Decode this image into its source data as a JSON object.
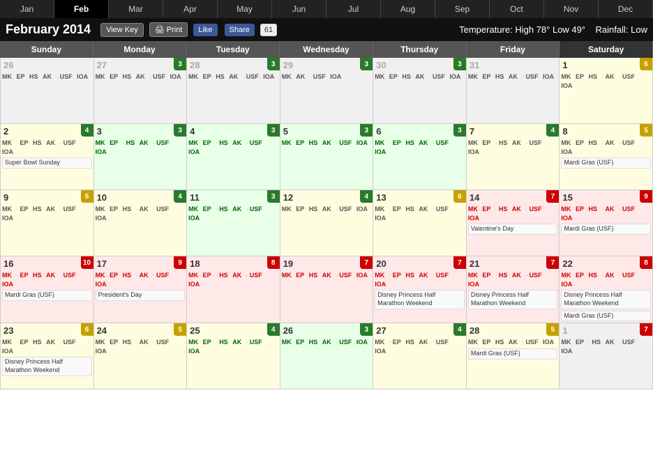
{
  "nav": {
    "months": [
      "Jan",
      "Feb",
      "Mar",
      "Apr",
      "May",
      "Jun",
      "Jul",
      "Aug",
      "Sep",
      "Oct",
      "Nov",
      "Dec"
    ],
    "active": "Feb"
  },
  "header": {
    "title": "February 2014",
    "view_key": "View Key",
    "print": "Print",
    "fb_like": "Like",
    "fb_share": "Share",
    "share_count": "61",
    "weather_label": "Temperature:",
    "weather_high": "High 78°",
    "weather_low": "Low 49°",
    "rainfall_label": "Rainfall:",
    "rainfall_value": "Low"
  },
  "dow": [
    "Sunday",
    "Monday",
    "Tuesday",
    "Wednesday",
    "Thursday",
    "Friday",
    "Saturday"
  ],
  "cells": [
    {
      "day": "26",
      "other": true,
      "crowd": null,
      "bg": "other",
      "parks": "MK EP HS AK · USF IOA",
      "parks_color": "gray",
      "events": []
    },
    {
      "day": "27",
      "other": true,
      "crowd": 3,
      "bg": "other",
      "parks": "MK EP HS AK · USF IOA",
      "parks_color": "gray",
      "events": []
    },
    {
      "day": "28",
      "other": true,
      "crowd": 3,
      "bg": "other",
      "parks": "MK EP HS AK · USF IOA",
      "parks_color": "gray",
      "events": []
    },
    {
      "day": "29",
      "other": true,
      "crowd": 3,
      "bg": "other",
      "parks": "MK AK · USF IOA",
      "parks_color": "gray",
      "events": []
    },
    {
      "day": "30",
      "other": true,
      "crowd": 3,
      "bg": "other",
      "parks": "MK EP HS AK · USF IOA",
      "parks_color": "gray",
      "events": []
    },
    {
      "day": "31",
      "other": true,
      "crowd": null,
      "bg": "other",
      "parks": "MK EP HS AK · USF IOA",
      "parks_color": "gray",
      "events": []
    },
    {
      "day": "1",
      "other": false,
      "crowd": 6,
      "bg": "yellow",
      "parks": "MK EP HS · AK · USF IOA",
      "parks_color": "gray",
      "events": []
    },
    {
      "day": "2",
      "other": false,
      "crowd": 4,
      "bg": "yellow",
      "parks": "MK · EP HS AK · USF IOA",
      "parks_color": "mixed",
      "events": [
        "Super Bowl Sunday"
      ]
    },
    {
      "day": "3",
      "other": false,
      "crowd": 3,
      "bg": "green",
      "parks": "MK EP · HS AK · USF IOA",
      "parks_color": "green",
      "events": []
    },
    {
      "day": "4",
      "other": false,
      "crowd": 3,
      "bg": "green",
      "parks": "MK EP · HS AK · USF IOA",
      "parks_color": "green",
      "events": []
    },
    {
      "day": "5",
      "other": false,
      "crowd": 3,
      "bg": "green",
      "parks": "MK EP HS AK · USF IOA",
      "parks_color": "green",
      "events": []
    },
    {
      "day": "6",
      "other": false,
      "crowd": 3,
      "bg": "green",
      "parks": "MK · EP HS AK · USF IOA",
      "parks_color": "green",
      "events": []
    },
    {
      "day": "7",
      "other": false,
      "crowd": 4,
      "bg": "yellow",
      "parks": "MK EP · HS AK · USF IOA",
      "parks_color": "mixed",
      "events": []
    },
    {
      "day": "8",
      "other": false,
      "crowd": 5,
      "bg": "yellow",
      "parks": "MK EP HS · AK · USF IOA",
      "parks_color": "mixed",
      "events": [
        "Mardi Gras (USF)"
      ]
    },
    {
      "day": "9",
      "other": false,
      "crowd": 5,
      "bg": "yellow",
      "parks": "MK · EP HS AK · USF IOA",
      "parks_color": "mixed",
      "events": []
    },
    {
      "day": "10",
      "other": false,
      "crowd": 4,
      "bg": "yellow",
      "parks": "MK EP HS · AK · USF IOA",
      "parks_color": "mixed",
      "events": []
    },
    {
      "day": "11",
      "other": false,
      "crowd": 3,
      "bg": "green",
      "parks": "MK EP · HS AK · USF IOA",
      "parks_color": "green",
      "events": []
    },
    {
      "day": "12",
      "other": false,
      "crowd": 4,
      "bg": "yellow",
      "parks": "MK EP HS AK · USF IOA",
      "parks_color": "mixed",
      "events": []
    },
    {
      "day": "13",
      "other": false,
      "crowd": 6,
      "bg": "yellow",
      "parks": "MK · EP HS AK · USF IOA",
      "parks_color": "mixed",
      "events": []
    },
    {
      "day": "14",
      "other": false,
      "crowd": 7,
      "bg": "red",
      "parks": "MK EP · HS AK · USF IOA",
      "parks_color": "red",
      "events": [
        "Valentine's Day"
      ]
    },
    {
      "day": "15",
      "other": false,
      "crowd": 9,
      "bg": "red",
      "parks": "MK EP HS · AK · USF IOA",
      "parks_color": "red",
      "events": [
        "Mardi Gras (USF)"
      ]
    },
    {
      "day": "16",
      "other": false,
      "crowd": 10,
      "bg": "red",
      "parks": "MK · EP HS AK · USF IOA",
      "parks_color": "red",
      "events": [
        "Mardi Gras (USF)"
      ]
    },
    {
      "day": "17",
      "other": false,
      "crowd": 9,
      "bg": "red",
      "parks": "MK EP HS · AK · USF IOA",
      "parks_color": "red",
      "events": [
        "President's Day"
      ]
    },
    {
      "day": "18",
      "other": false,
      "crowd": 8,
      "bg": "red",
      "parks": "MK EP · HS AK · USF IOA",
      "parks_color": "red",
      "events": []
    },
    {
      "day": "19",
      "other": false,
      "crowd": 7,
      "bg": "red",
      "parks": "MK EP HS AK · USF IOA",
      "parks_color": "red",
      "events": []
    },
    {
      "day": "20",
      "other": false,
      "crowd": 7,
      "bg": "red",
      "parks": "MK · EP HS AK · USF IOA",
      "parks_color": "red",
      "events": [
        "Disney Princess Half Marathon Weekend"
      ]
    },
    {
      "day": "21",
      "other": false,
      "crowd": 7,
      "bg": "red",
      "parks": "MK EP · HS AK · USF IOA",
      "parks_color": "red",
      "events": [
        "Disney Princess Half Marathon Weekend"
      ]
    },
    {
      "day": "22",
      "other": false,
      "crowd": 8,
      "bg": "red",
      "parks": "MK EP HS · AK · USF IOA",
      "parks_color": "red",
      "events": [
        "Disney Princess Half Marathon Weekend",
        "Mardi Gras (USF)"
      ]
    },
    {
      "day": "23",
      "other": false,
      "crowd": 6,
      "bg": "yellow",
      "parks": "MK · EP HS AK · USF IOA",
      "parks_color": "mixed",
      "events": [
        "Disney Princess Half Marathon Weekend"
      ]
    },
    {
      "day": "24",
      "other": false,
      "crowd": 5,
      "bg": "yellow",
      "parks": "MK EP HS · AK · USF IOA",
      "parks_color": "mixed",
      "events": []
    },
    {
      "day": "25",
      "other": false,
      "crowd": 4,
      "bg": "yellow",
      "parks": "MK EP · HS AK · USF IOA",
      "parks_color": "green",
      "events": []
    },
    {
      "day": "26",
      "other": false,
      "crowd": 3,
      "bg": "green",
      "parks": "MK EP HS AK · USF IOA",
      "parks_color": "green",
      "events": []
    },
    {
      "day": "27",
      "other": false,
      "crowd": 4,
      "bg": "yellow",
      "parks": "MK · EP HS AK · USF IOA",
      "parks_color": "mixed",
      "events": []
    },
    {
      "day": "28",
      "other": false,
      "crowd": 5,
      "bg": "yellow",
      "parks": "MK EP HS AK · USF IOA",
      "parks_color": "mixed",
      "events": [
        "Mardi Gras (USF)"
      ]
    },
    {
      "day": "1",
      "other": true,
      "crowd": 7,
      "bg": "other",
      "parks": "MK EP · HS AK · USF IOA",
      "parks_color": "gray",
      "events": []
    }
  ]
}
